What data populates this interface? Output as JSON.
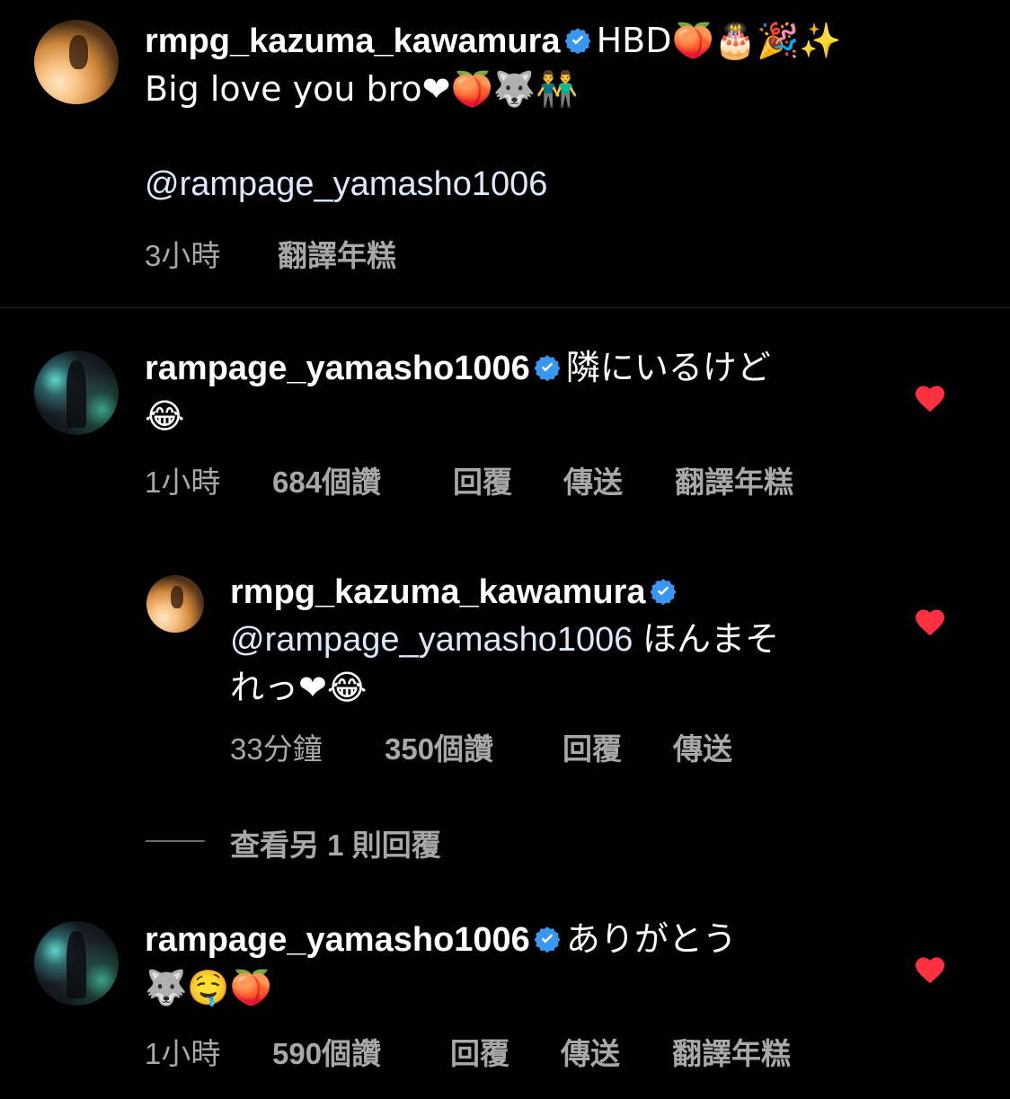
{
  "caption": {
    "username": "rmpg_kazuma_kawamura",
    "line1": "HBD🍑🎂🎉✨",
    "line2": "Big love you bro❤🍑🐺👬",
    "mention": "@rampage_yamasho1006",
    "time": "3小時",
    "translate": "翻譯年糕"
  },
  "comments": [
    {
      "username": "rampage_yamasho1006",
      "text_line1": "隣にいるけど",
      "text_line2": "😂",
      "time": "1小時",
      "likes": "684個讚",
      "reply": "回覆",
      "send": "傳送",
      "translate": "翻譯年糕"
    },
    {
      "username": "rmpg_kazuma_kawamura",
      "mention": "@rampage_yamasho1006",
      "text_line1_rest": " ほんまそ",
      "text_line2": "れっ❤😂",
      "time": "33分鐘",
      "likes": "350個讚",
      "reply": "回覆",
      "send": "傳送"
    },
    {
      "username": "rampage_yamasho1006",
      "text_line1": "ありがとう",
      "text_line2": "🐺🤤🍑",
      "time": "1小時",
      "likes": "590個讚",
      "reply": "回覆",
      "send": "傳送",
      "translate": "翻譯年糕"
    }
  ],
  "view_more_replies": "查看另 1 則回覆",
  "colors": {
    "background": "#000000",
    "text": "#ffffff",
    "meta": "#a8a8a8",
    "verified": "#3897f0",
    "heart": "#ff3040",
    "mention": "#dce8fb"
  }
}
